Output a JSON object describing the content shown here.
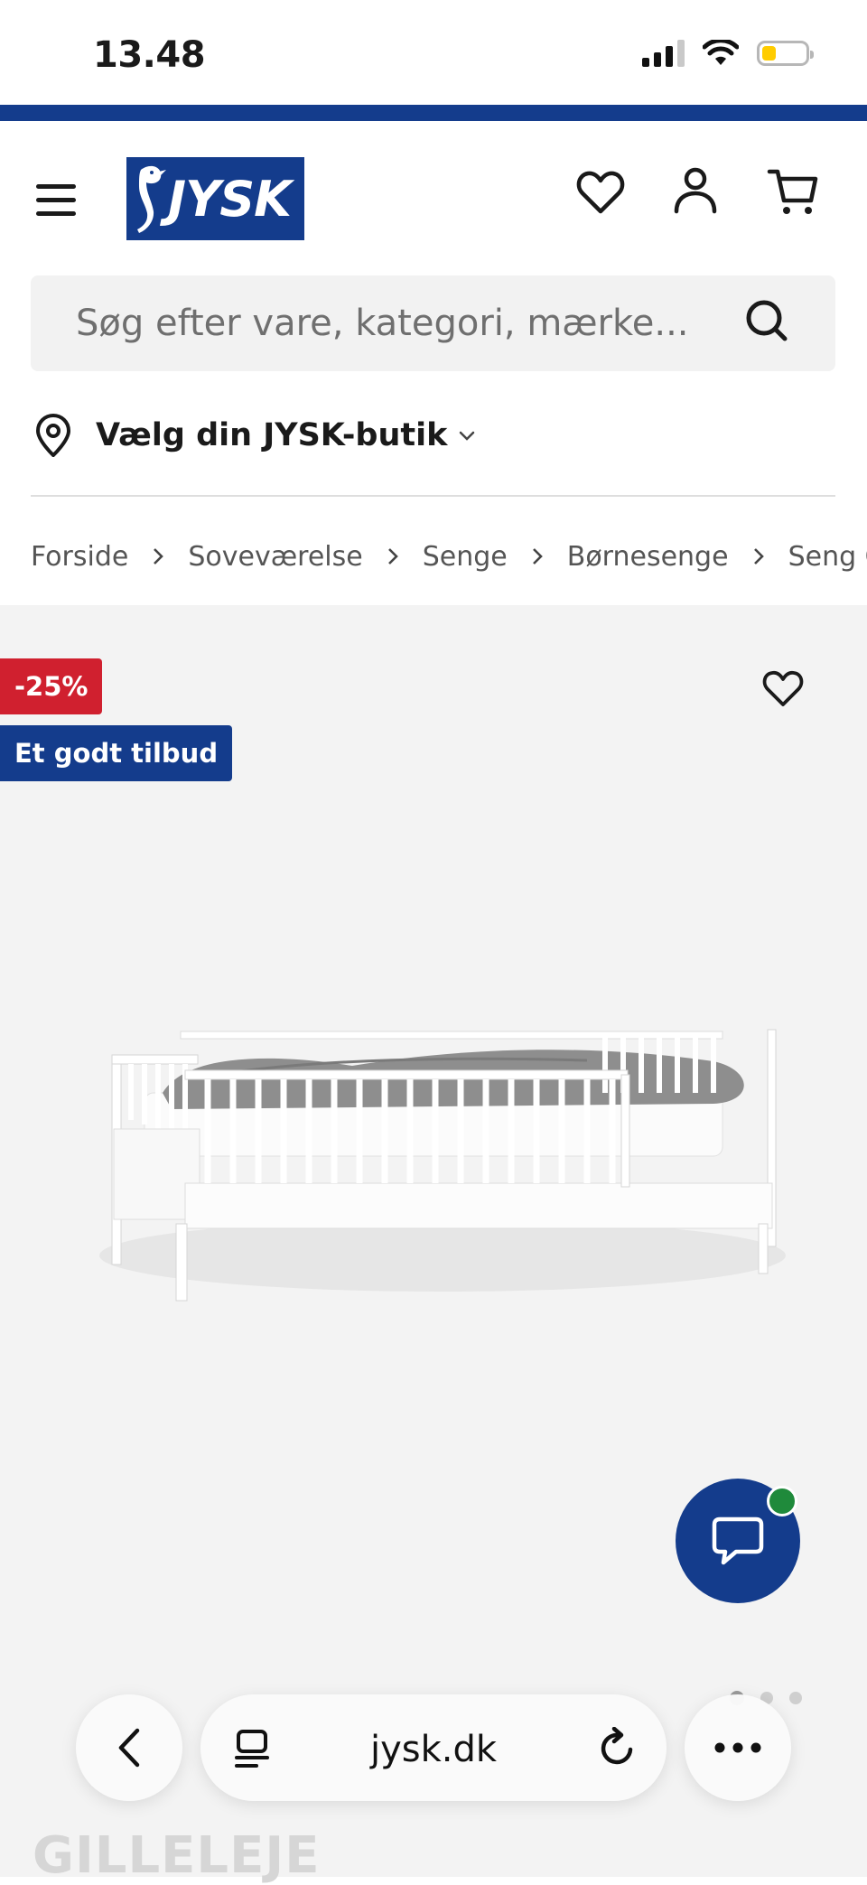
{
  "status_bar": {
    "time": "13.48"
  },
  "header": {
    "logo_text": "JYSK"
  },
  "search": {
    "placeholder": "Søg efter vare, kategori, mærke..."
  },
  "store_selector": {
    "label": "Vælg din JYSK-butik"
  },
  "breadcrumb": [
    "Forside",
    "Soveværelse",
    "Senge",
    "Børnesenge",
    "Seng GILL"
  ],
  "product": {
    "badges": {
      "discount": "-25%",
      "offer": "Et godt tilbud"
    },
    "title_partial": "GILLELEJE",
    "image_count": 3,
    "active_image": 1
  },
  "browser": {
    "url": "jysk.dk"
  },
  "colors": {
    "brand_blue": "#143c8c",
    "discount_red": "#d0202f",
    "chat_online": "#1f8a3b"
  }
}
